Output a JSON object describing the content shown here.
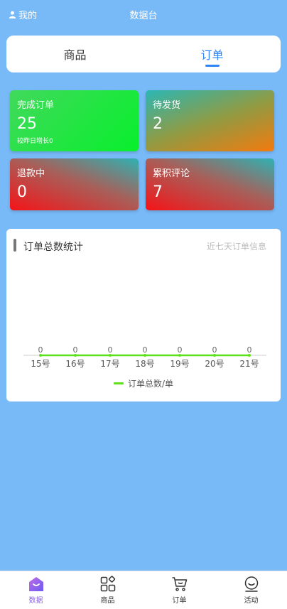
{
  "header": {
    "me_label": "我的",
    "title": "数据台"
  },
  "tabs": [
    {
      "label": "商品",
      "active": false
    },
    {
      "label": "订单",
      "active": true
    }
  ],
  "cards": [
    {
      "label": "完成订单",
      "value": "25",
      "sub": "较昨日增长0"
    },
    {
      "label": "待发货",
      "value": "2"
    },
    {
      "label": "退款中",
      "value": "0"
    },
    {
      "label": "累积评论",
      "value": "7"
    }
  ],
  "stats": {
    "title": "订单总数统计",
    "right_label": "近七天订单信息"
  },
  "chart_data": {
    "type": "line",
    "categories": [
      "15号",
      "16号",
      "17号",
      "18号",
      "19号",
      "20号",
      "21号"
    ],
    "series": [
      {
        "name": "订单总数/单",
        "values": [
          0,
          0,
          0,
          0,
          0,
          0,
          0
        ],
        "color": "#5ee11d"
      }
    ],
    "grid": false,
    "legend_position": "bottom"
  },
  "nav": [
    {
      "label": "数据",
      "icon": "home-icon",
      "active": true
    },
    {
      "label": "商品",
      "icon": "grid-icon",
      "active": false
    },
    {
      "label": "订单",
      "icon": "cart-icon",
      "active": false
    },
    {
      "label": "活动",
      "icon": "smile-icon",
      "active": false
    }
  ],
  "colors": {
    "background": "#78b9f8",
    "accent": "#2f86f6",
    "nav_active": "#8a63e8",
    "series": "#5ee11d"
  }
}
